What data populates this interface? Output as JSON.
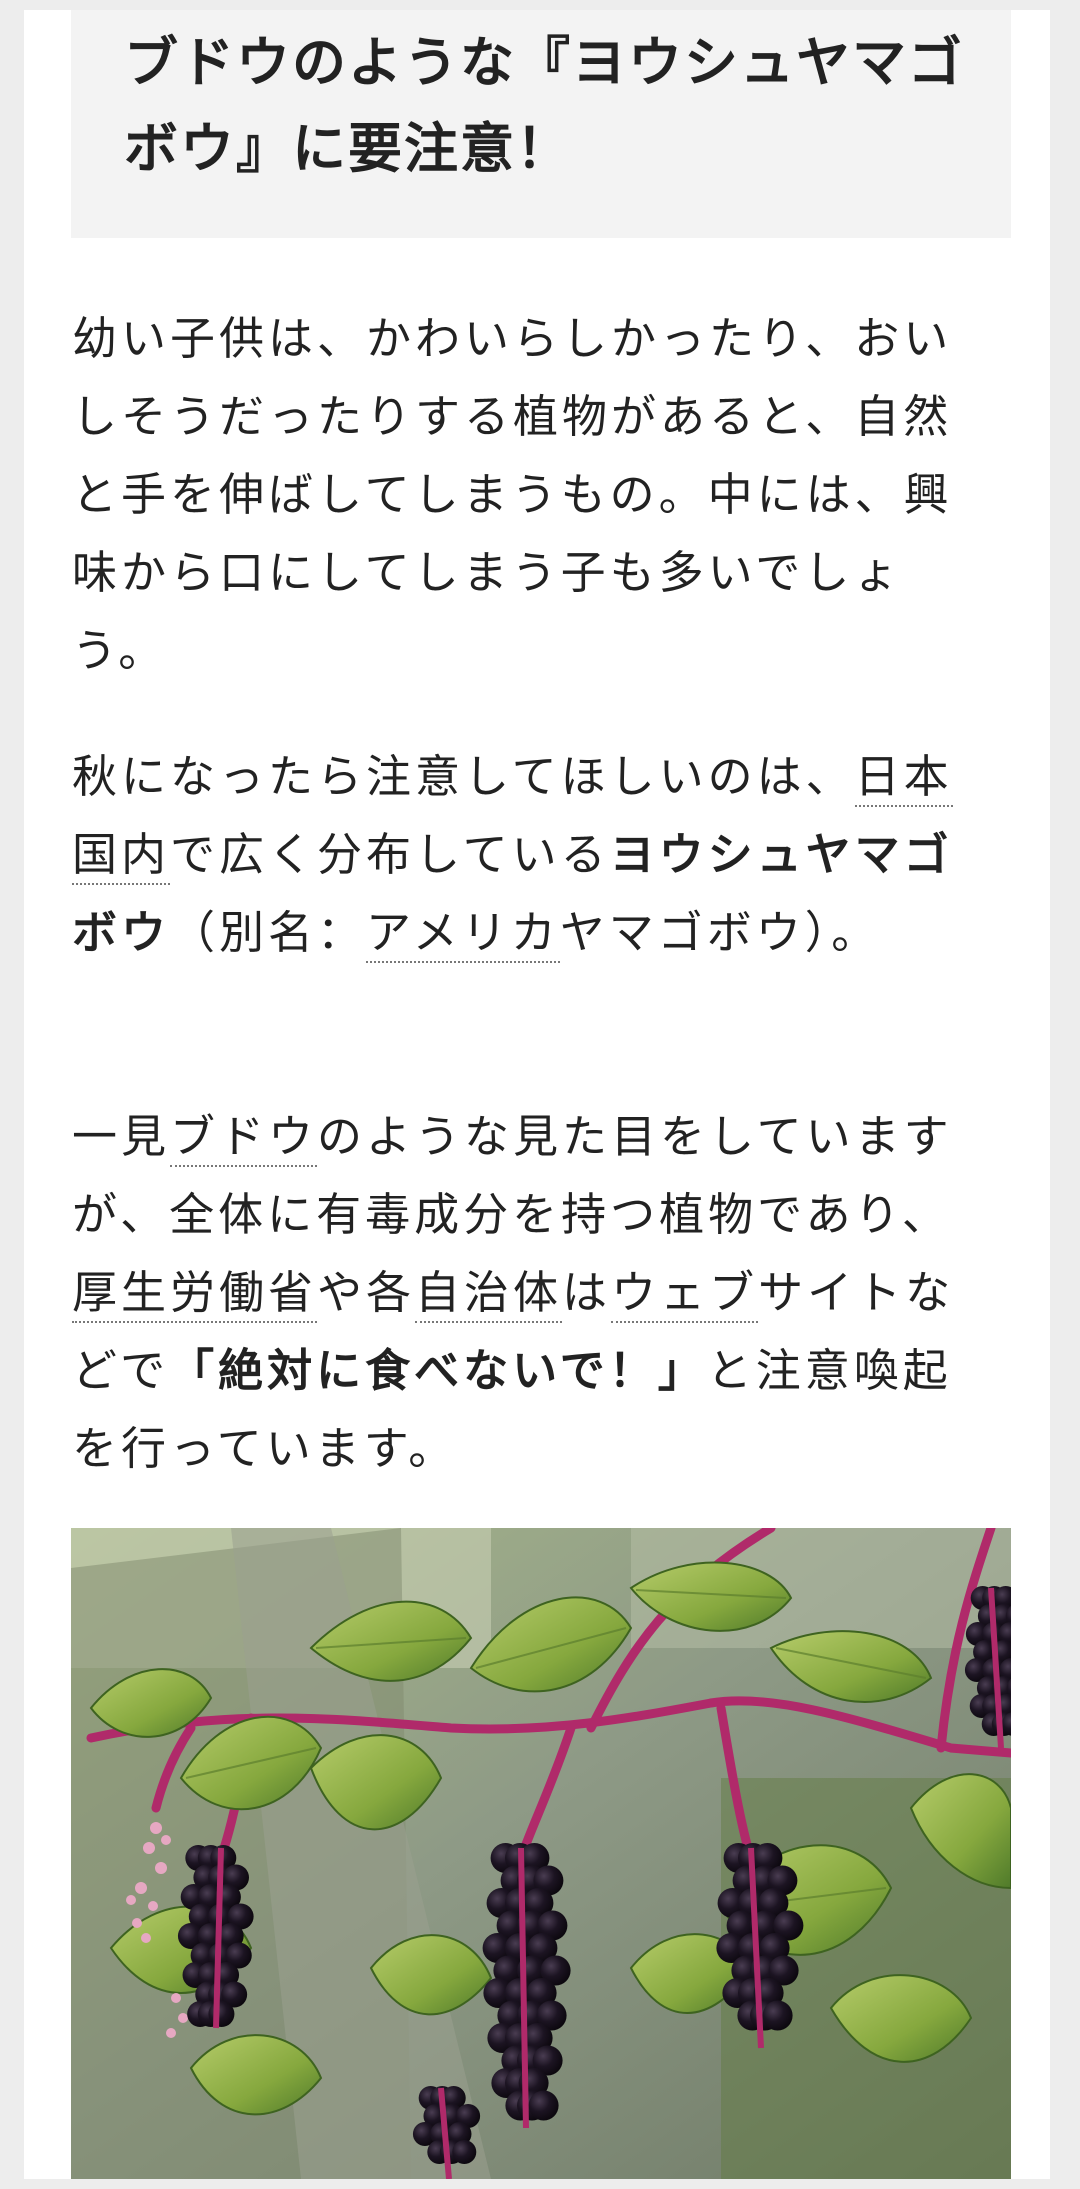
{
  "article": {
    "heading": "ブドウのような『ヨウシュヤマゴボウ』に要注意！",
    "paragraph1": "幼い子供は、かわいらしかったり、おいしそうだったりする植物があると、自然と手を伸ばしてしまうもの。中には、興味から口にしてしまう子も多いでしょう。",
    "paragraph2": {
      "text1": "秋になったら注意してほしいのは、",
      "link_japan": "日本国内",
      "text2": "で広く分布している",
      "bold_plant": "ヨウシュヤマゴボウ",
      "text3": "（別名：",
      "link_alias": "アメリカ",
      "text4": "ヤマゴボウ）。"
    },
    "paragraph3": {
      "text1": "一見",
      "link_grape": "ブドウ",
      "text2": "のような見た目をしていますが、全体に有毒成分を持つ植物であり、",
      "link_ministry": "厚生労働省",
      "text3": "や各",
      "link_municipality": "自治体",
      "text4": "は",
      "link_website": "ウェブ",
      "text5": "サイトなどで",
      "bold_warning": "「絶対に食べないで！」",
      "text6": "と注意喚起を行っています。"
    },
    "image_alt": "ヨウシュヤマゴボウ"
  },
  "colors": {
    "heading_bg": "#f3f3f3",
    "page_bg": "#ffffff",
    "outer_bg": "#ededed",
    "text": "#222222",
    "berry": "#1c1422",
    "stem": "#b02a6a",
    "leaf": "#7fa33a"
  }
}
